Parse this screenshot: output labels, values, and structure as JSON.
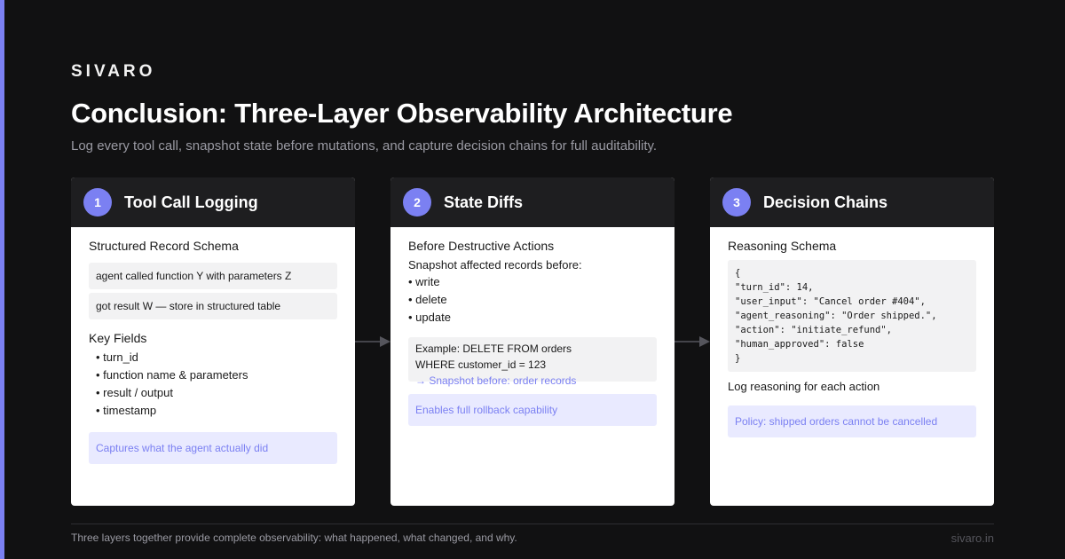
{
  "brand": "SIVARO",
  "title": "Conclusion: Three-Layer Observability Architecture",
  "subtitle": "Log every tool call, snapshot state before mutations, and capture decision chains for full auditability.",
  "cards": [
    {
      "number": "1",
      "title": "Tool Call Logging",
      "section1": "Structured Record Schema",
      "records": [
        "agent called function Y with parameters Z",
        "got result W — store in structured table"
      ],
      "section2": "Key Fields",
      "fields": [
        "• turn_id",
        "• function name & parameters",
        "• result / output",
        "• timestamp"
      ],
      "note": "Captures what the agent actually did"
    },
    {
      "number": "2",
      "title": "State Diffs",
      "section1": "Before Destructive Actions",
      "intro": "Snapshot affected records before:",
      "actions": [
        "• write",
        "• delete",
        "• update"
      ],
      "example_line1": "Example: DELETE FROM orders",
      "example_line2": "WHERE customer_id = 123",
      "example_line3": "→ Snapshot before: order records",
      "note": "Enables full rollback capability"
    },
    {
      "number": "3",
      "title": "Decision Chains",
      "section1": "Reasoning Schema",
      "code": "{\n\"turn_id\": 14,\n\"user_input\": \"Cancel order #404\",\n\"agent_reasoning\": \"Order shipped.\",\n\"action\": \"initiate_refund\",\n\"human_approved\": false\n}",
      "section2": "Log reasoning for each action",
      "note": "Policy: shipped orders cannot be cancelled"
    }
  ],
  "footer": {
    "text": "Three layers together provide complete observability: what happened, what changed, and why.",
    "url": "sivaro.in"
  },
  "colors": {
    "background": "#111112",
    "accent": "#7b80f2",
    "card_header": "#1e1e20",
    "note_bg": "#e9eaff",
    "muted": "#9a9aa3"
  }
}
